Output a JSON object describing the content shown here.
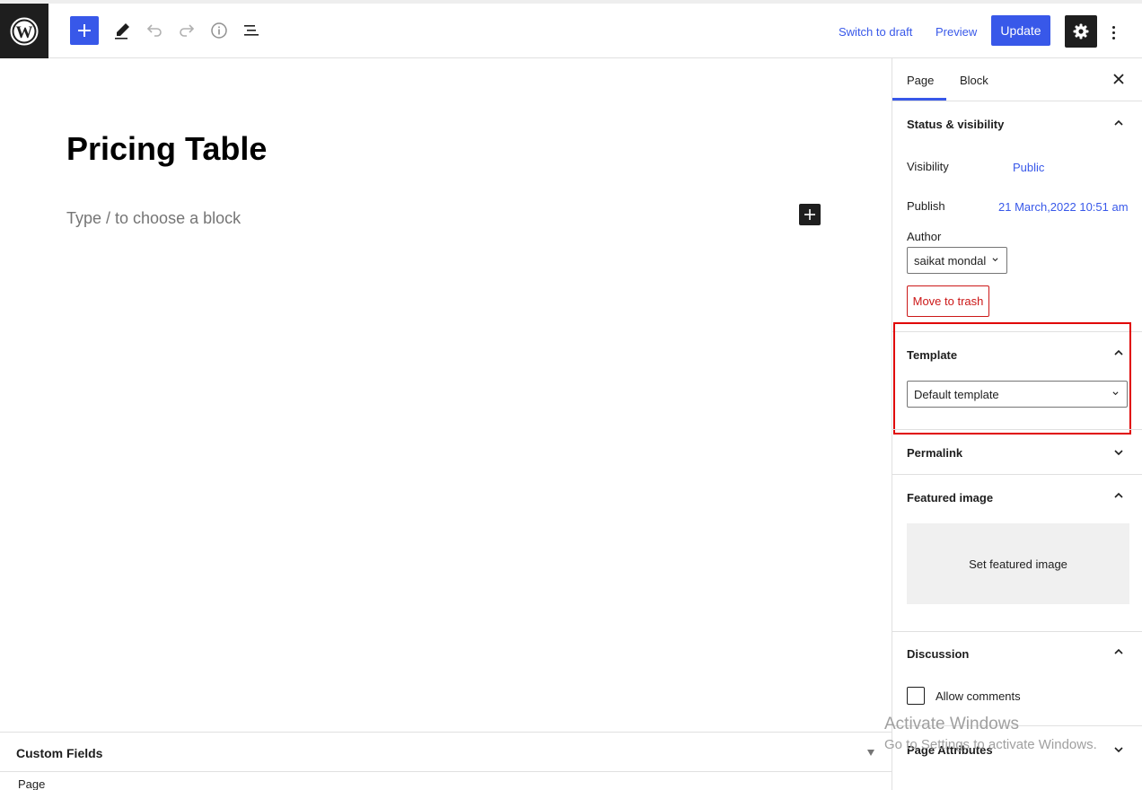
{
  "toolbar": {
    "switch_to_draft": "Switch to draft",
    "preview": "Preview",
    "update": "Update"
  },
  "editor": {
    "title": "Pricing Table",
    "block_placeholder": "Type / to choose a block"
  },
  "sidebar": {
    "tabs": [
      "Page",
      "Block"
    ],
    "status_visibility": {
      "title": "Status & visibility",
      "visibility_label": "Visibility",
      "visibility_value": "Public",
      "publish_label": "Publish",
      "publish_value": "21 March,2022 10:51 am",
      "author_label": "Author",
      "author_value": "saikat mondal",
      "trash_label": "Move to trash"
    },
    "template": {
      "title": "Template",
      "selected": "Default template"
    },
    "permalink": {
      "title": "Permalink"
    },
    "featured_image": {
      "title": "Featured image",
      "button": "Set featured image"
    },
    "discussion": {
      "title": "Discussion",
      "allow_comments": "Allow comments"
    },
    "page_attributes": {
      "title": "Page Attributes"
    }
  },
  "footer": {
    "custom_fields": "Custom Fields",
    "status": "Page"
  },
  "watermark": {
    "line1": "Activate Windows",
    "line2": "Go to Settings to activate Windows."
  },
  "colors": {
    "accent": "#3858e9",
    "dark": "#1e1e1e",
    "danger": "#cc1818",
    "highlight": "#e00000"
  }
}
